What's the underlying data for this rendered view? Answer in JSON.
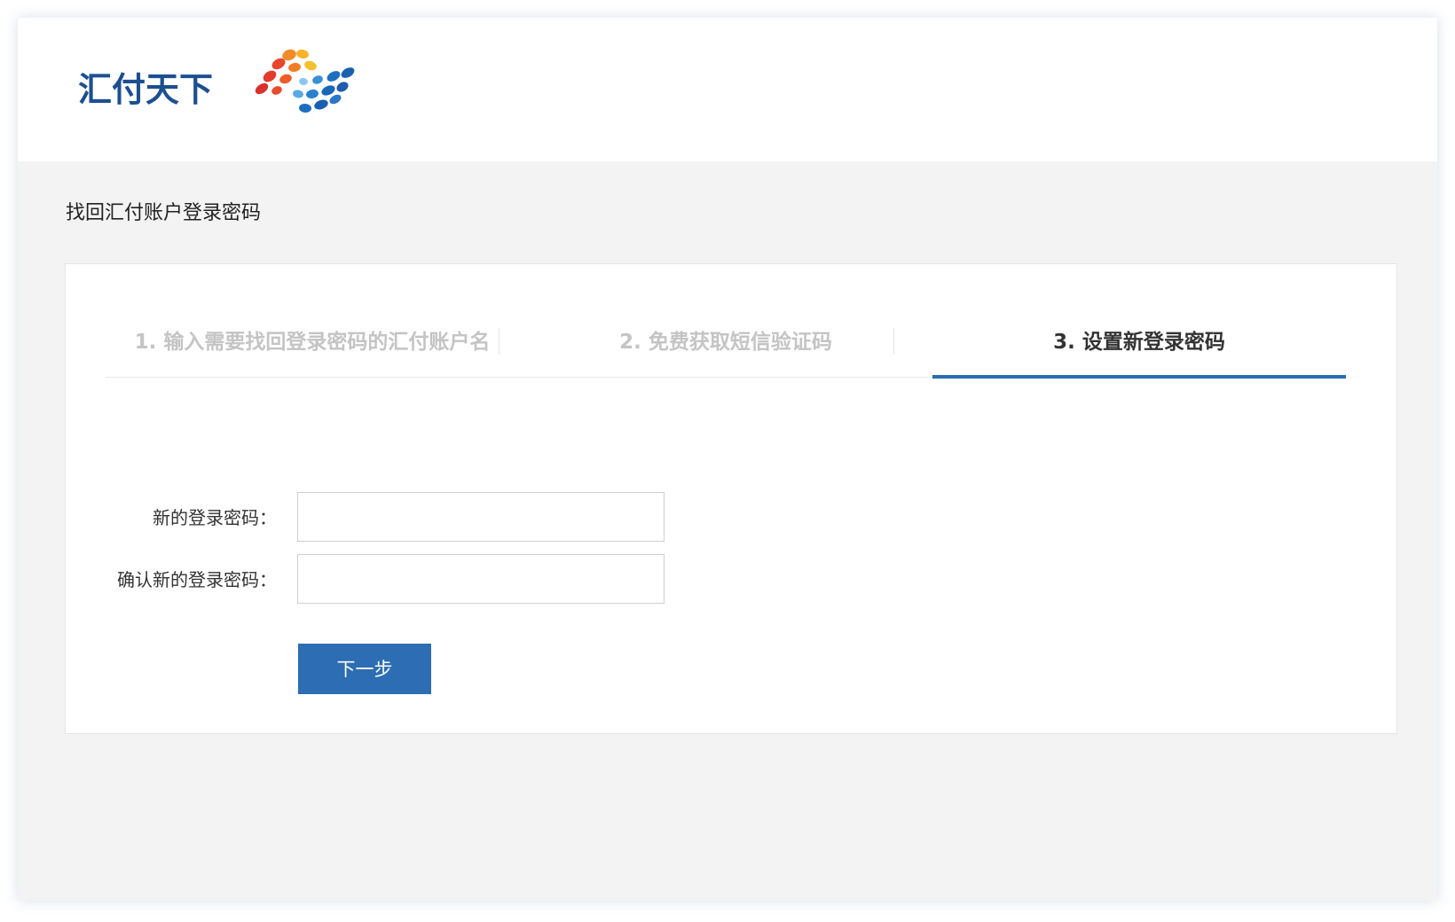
{
  "header": {
    "logo_text": "汇付天下",
    "logo_icon": "colorful-dots-logo-icon"
  },
  "page": {
    "title": "找回汇付账户登录密码"
  },
  "steps": [
    {
      "label": "1. 输入需要找回登录密码的汇付账户名",
      "state": "done"
    },
    {
      "label": "2. 免费获取短信验证码",
      "state": "done"
    },
    {
      "label": "3. 设置新登录密码",
      "state": "active"
    }
  ],
  "form": {
    "new_password_label": "新的登录密码：",
    "new_password_value": "",
    "confirm_password_label": "确认新的登录密码：",
    "confirm_password_value": "",
    "next_button_label": "下一步"
  },
  "colors": {
    "accent": "#2c6db3",
    "logo_text": "#1d4f8f",
    "step_inactive": "#c4c4c4",
    "step_active": "#333333",
    "page_background": "#f3f3f3"
  }
}
